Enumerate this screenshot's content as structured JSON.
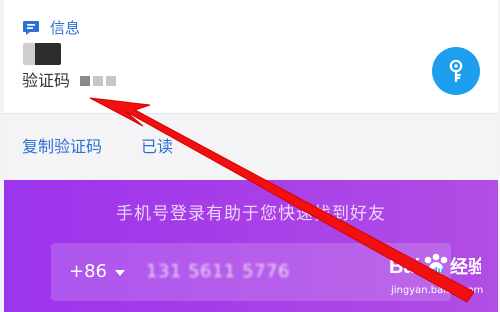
{
  "notification": {
    "app_label": "信息",
    "body_label": "验证码",
    "app_icon": "chat-icon",
    "action_icon": "key-icon",
    "accent_color": "#2e6fd7",
    "key_color": "#1d9ff0"
  },
  "actions": {
    "copy_label": "复制验证码",
    "second_label": "已读"
  },
  "login": {
    "subtitle": "手机号登录有助于您快速找到好友",
    "country_code": "+86",
    "phone_value": "131 5611 5776"
  },
  "watermark": {
    "brand": "Baidu经验",
    "domain": "jingyan.baidu.com"
  },
  "annotation": {
    "arrow_color": "#f10f0f",
    "arrow_icon": "red-arrow"
  }
}
